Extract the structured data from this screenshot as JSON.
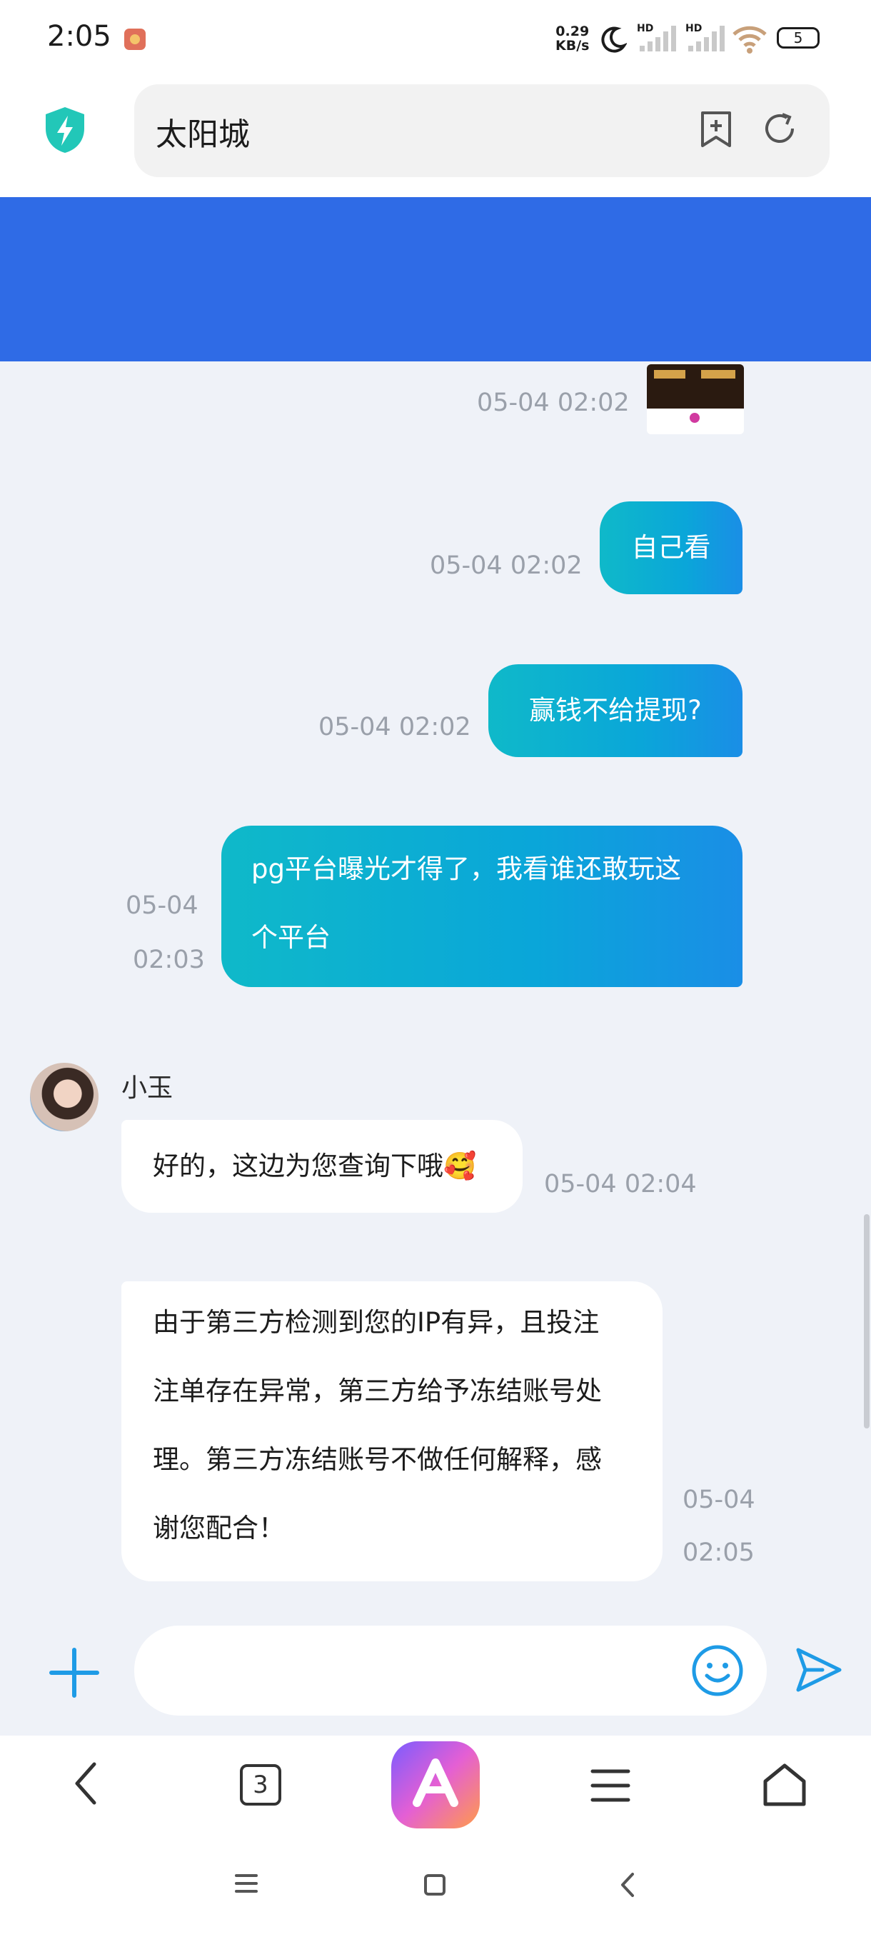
{
  "status_bar": {
    "time": "2:05",
    "network_speed_value": "0.29",
    "network_speed_unit": "KB/s",
    "signal_label_1": "HD",
    "signal_label_2": "HD",
    "battery_level": "5"
  },
  "browser": {
    "address_text": "太阳城",
    "tab_count": "3",
    "icons": [
      "shield-icon",
      "bookmark-add-icon",
      "refresh-icon",
      "back-icon",
      "tabs-icon",
      "app-logo",
      "menu-icon",
      "home-icon"
    ]
  },
  "colors": {
    "banner": "#2f6be6",
    "outgoing_bubble_start": "#0fb9c9",
    "outgoing_bubble_end": "#1a8ee6",
    "chat_background": "#eff2f8",
    "accent_blue": "#1e9be6"
  },
  "chat": {
    "messages": [
      {
        "direction": "outgoing",
        "type": "image",
        "time": "05-04 02:02"
      },
      {
        "direction": "outgoing",
        "type": "text",
        "text": "自己看",
        "time": "05-04 02:02"
      },
      {
        "direction": "outgoing",
        "type": "text",
        "text": "赢钱不给提现?",
        "time": "05-04 02:02"
      },
      {
        "direction": "outgoing",
        "type": "text",
        "lines": [
          "pg平台曝光才得了，我看谁还敢玩这",
          "个平台"
        ],
        "time_lines": [
          "05-04",
          "02:03"
        ]
      },
      {
        "direction": "incoming",
        "sender": "小玉",
        "type": "text",
        "text": "好的，这边为您查询下哦🥰",
        "time": "05-04 02:04"
      },
      {
        "direction": "incoming",
        "type": "text",
        "lines": [
          "由于第三方检测到您的IP有异，且投注",
          "注单存在异常，第三方给予冻结账号处",
          "理。第三方冻结账号不做任何解释，感",
          "谢您配合！"
        ],
        "time_lines": [
          "05-04",
          "02:05"
        ]
      }
    ]
  },
  "input": {
    "value": "",
    "icons": [
      "plus-icon",
      "emoji-icon",
      "send-icon"
    ]
  },
  "system_nav": {
    "icons": [
      "sys-menu-icon",
      "sys-home-icon",
      "sys-back-icon"
    ]
  }
}
